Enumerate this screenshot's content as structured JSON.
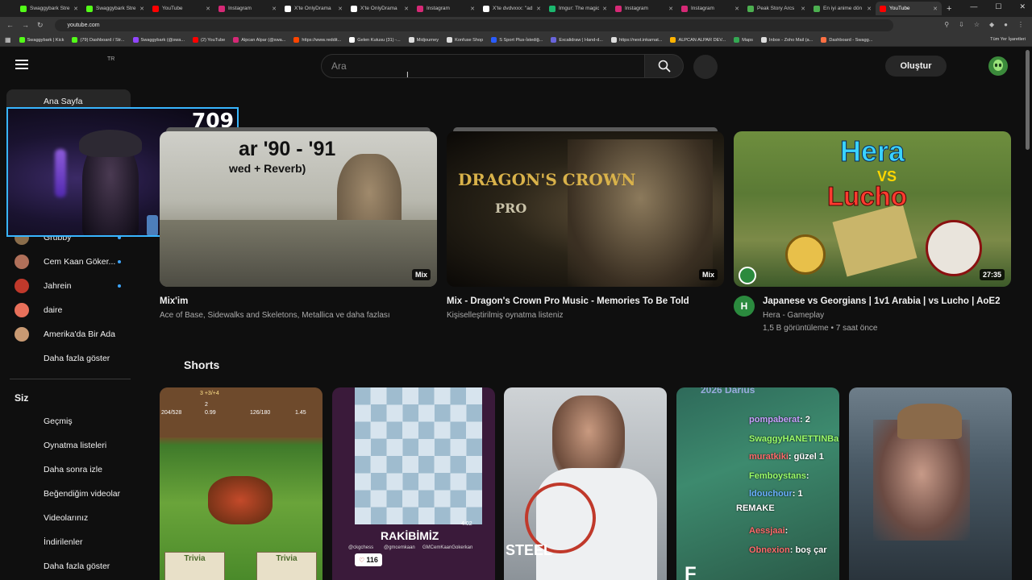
{
  "browser": {
    "tabs": [
      {
        "label": "Swaggybark Stre",
        "favicon": "kick-icon",
        "color": "#53fc18"
      },
      {
        "label": "Swaggybark Stre",
        "favicon": "kick-icon",
        "color": "#53fc18"
      },
      {
        "label": "YouTube",
        "favicon": "youtube-icon",
        "color": "#ff0000"
      },
      {
        "label": "Instagram",
        "favicon": "instagram-icon",
        "color": "#d62976"
      },
      {
        "label": "X'te OnlyDrama",
        "favicon": "x-icon",
        "color": "#ffffff"
      },
      {
        "label": "X'te OnlyDrama",
        "favicon": "x-icon",
        "color": "#ffffff"
      },
      {
        "label": "Instagram",
        "favicon": "instagram-icon",
        "color": "#d62976"
      },
      {
        "label": "X'te dvdvxxx: \"adı",
        "favicon": "x-icon",
        "color": "#ffffff"
      },
      {
        "label": "Imgur: The magic",
        "favicon": "imgur-icon",
        "color": "#1bb76e"
      },
      {
        "label": "Instagram",
        "favicon": "instagram-icon",
        "color": "#d62976"
      },
      {
        "label": "Instagram",
        "favicon": "instagram-icon",
        "color": "#d62976"
      },
      {
        "label": "Peak Story Arcs",
        "favicon": "page-icon",
        "color": "#4caf50"
      },
      {
        "label": "En iyi anime dön",
        "favicon": "page-icon",
        "color": "#4caf50"
      },
      {
        "label": "YouTube",
        "favicon": "youtube-icon",
        "color": "#ff0000",
        "active": true
      }
    ],
    "url": "youtube.com",
    "bookmarks": [
      {
        "label": "Swaggybark | Kick",
        "color": "#53fc18"
      },
      {
        "label": "(79) Dashboard / Str...",
        "color": "#53fc18"
      },
      {
        "label": "Swaggybark (@swa...",
        "color": "#9146ff"
      },
      {
        "label": "(2) YouTube",
        "color": "#ff0000"
      },
      {
        "label": "Alpcan Alpar (@swa...",
        "color": "#d62976"
      },
      {
        "label": "https://www.reddit...",
        "color": "#ff4500"
      },
      {
        "label": "Gelen Kutusu (31) -...",
        "color": "#ffffff"
      },
      {
        "label": "Midjourney",
        "color": "#dddddd"
      },
      {
        "label": "Konfuse Shop",
        "color": "#dddddd"
      },
      {
        "label": "S Sport Plus-İstediğ...",
        "color": "#2a5cff"
      },
      {
        "label": "Excalidraw | Hand-d...",
        "color": "#6965db"
      },
      {
        "label": "https://next.inkarnat...",
        "color": "#dddddd"
      },
      {
        "label": "ALPCAN ALPAR DEV...",
        "color": "#ffb300"
      },
      {
        "label": "Maps",
        "color": "#34a853"
      },
      {
        "label": "Inbox - Zoho Mail (a...",
        "color": "#dddddd"
      },
      {
        "label": "Dashboard - Swagg...",
        "color": "#ff7043"
      }
    ],
    "all_bookmarks": "Tüm Yer İşaretleri"
  },
  "header": {
    "region": "TR",
    "search_placeholder": "Ara",
    "create_label": "Oluştur"
  },
  "sidebar": {
    "home": "Ana Sayfa",
    "subscriptions": [
      {
        "label": "Grubby",
        "color": "#8a6d4b"
      },
      {
        "label": "Cem Kaan Göker...",
        "color": "#b0705a"
      },
      {
        "label": "Jahrein",
        "color": "#c0392b"
      },
      {
        "label": "daire",
        "color": "#e8705a"
      },
      {
        "label": "Amerika'da Bir Ada",
        "color": "#c99a73"
      }
    ],
    "show_more": "Daha fazla göster",
    "you_heading": "Siz",
    "you_items": [
      "Geçmiş",
      "Oynatma listeleri",
      "Daha sonra izle",
      "Beğendiğim videolar",
      "Videolarınız",
      "İndirilenler",
      "Daha fazla göster"
    ]
  },
  "webcam": {
    "counter": "709"
  },
  "videos": [
    {
      "title": "Mix'im",
      "subtitle": "Ace of Base, Sidewalks and Skeletons, Metallica ve daha fazlası",
      "badge": "Mix",
      "thumb_text_1": "ar '90 - '91",
      "thumb_text_2": "wed + Reverb)"
    },
    {
      "title": "Mix - Dragon's Crown Pro Music - Memories To Be Told",
      "subtitle": "Kişiselleştirilmiş oynatma listeniz",
      "badge": "Mix",
      "thumb_text_1": "DRAGON'S CROWN",
      "thumb_text_2": "PRO"
    },
    {
      "title": "Japanese vs Georgians | 1v1 Arabia | vs Lucho | AoE2",
      "channel": "Hera - Gameplay",
      "meta": "1,5 B görüntüleme • 7 saat önce",
      "badge": "27:35",
      "channel_initial": "H",
      "thumb_text_1": "Hera",
      "thumb_text_2": "VS",
      "thumb_text_3": "Lucho"
    }
  ],
  "shorts": {
    "heading": "Shorts",
    "items": [
      {
        "text_1": "Trivia",
        "text_2": "Trivia",
        "stat_1": "3 +3/+4",
        "stat_2": "204/528",
        "stat_3": "2",
        "stat_4": "0.99",
        "stat_5": "126/180",
        "stat_6": "1.45"
      },
      {
        "text_1": "RAKİBİMİZ",
        "text_2": "116",
        "text_3": "4:02",
        "text_4": "@ckgchess",
        "text_5": "@gmcemkaan",
        "text_6": "GMCemKaanGokerkan"
      },
      {
        "text_1": "STEEL"
      },
      {
        "text_1": "2026 Darius",
        "chat": [
          {
            "user": "pompaberat",
            "msg": ": 2"
          },
          {
            "user": "SwaggyHANETTINBarkoglu",
            "msg": ":"
          },
          {
            "user": "muratkiki",
            "msg": ": güzel 1"
          },
          {
            "user": "Femboystans",
            "msg": ":"
          },
          {
            "user": "ldouchour",
            "msg": ": 1"
          },
          {
            "user": "REMAKE",
            "msg": ""
          },
          {
            "user": "Aessjaai",
            "msg": ":"
          },
          {
            "user": "Obnexion",
            "msg": ": boş çar"
          }
        ],
        "text_2": "F"
      },
      {
        "text_1": ""
      }
    ]
  }
}
